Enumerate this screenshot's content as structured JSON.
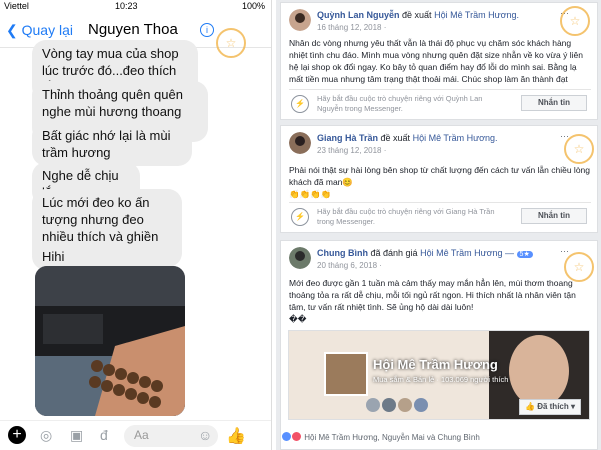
{
  "messenger": {
    "status": {
      "carrier": "Viettel",
      "time": "10:23",
      "battery": "100%"
    },
    "nav": {
      "back": "Quay lại",
      "title": "Nguyen Thoa",
      "info": "i"
    },
    "messages": [
      "Vòng tay mua của shop lúc trước đó...đeo thích lắm",
      "Thỉnh thoảng quên quên nghe mùi hương thoang thoảng",
      "Bất giác nhớ lại là mùi trầm hương",
      "Nghe dễ chịu lắm",
      "Lúc mới đeo ko ấn tượng nhưng đeo nhiều thích và ghiền luôn",
      "Hihi"
    ],
    "composer": {
      "placeholder": "Aa"
    }
  },
  "reviews": [
    {
      "name": "Quỳnh Lan Nguyễn",
      "action": "đề xuất",
      "page": "Hội Mê Trầm Hương.",
      "date": "16 tháng 12, 2018 ·",
      "text": "Nhân dc vòng nhưng yêu thất vẫn là thái độ phục vụ chăm sóc khách hàng nhiệt tình chu đáo. Mình mua vòng nhưng quên đặt size nhẫn về ko vừa ý liên hệ lại shop ok đổi ngay. Ko bây tỏ quan điểm hay đổ lỗi do mình sai. Bằng lạ mất tiền mua nhưng tâm trạng thật thoải mái. Chúc shop làm ăn thành đạt",
      "messenger_prompt": "Hãy bắt đầu cuộc trò chuyện riêng với Quỳnh Lan Nguyễn trong Messenger.",
      "button": "Nhắn tin"
    },
    {
      "name": "Giang Hà Trần",
      "action": "đề xuất",
      "page": "Hội Mê Trầm Hương.",
      "date": "23 tháng 12, 2018 ·",
      "text": "Phải nói thật sự hài lòng bên shop từ chất lượng đến cách tư vấn lẫn chiều lòng khách đã man😊",
      "emoji": "👏👏👏👏",
      "messenger_prompt": "Hãy bắt đầu cuộc trò chuyện riêng với Giang Hà Trần trong Messenger.",
      "button": "Nhắn tin"
    },
    {
      "name": "Chung Bình",
      "action": "đã đánh giá",
      "page": "Hội Mê Trầm Hương —",
      "rating": "5★",
      "date": "20 tháng 6, 2018 ·",
      "text": "Mới đeo được gần 1 tuần mà cảm thấy may mắn hẳn lên, mùi thơm thoang thoảng tỏa ra rất dễ chịu, mỗi tối ngủ rất ngon. Hi thích nhất là nhân viên tận tâm, tư vấn rất nhiệt tình. Sẽ ủng hộ dài dài luôn!",
      "extra": "��"
    }
  ],
  "page_card": {
    "name": "Hội Mê Trầm Hương",
    "meta": "Mua sắm & Bán lẻ · 103.069 người thích",
    "liked_button": "Đã thích"
  },
  "reactions": "Hội Mê Trầm Hương, Nguyễn Mai và Chung Bình",
  "watermark": "☆",
  "colors": {
    "messenger_blue": "#1f7bf5",
    "fb_blue": "#365899",
    "watermark": "#f2b54a"
  }
}
